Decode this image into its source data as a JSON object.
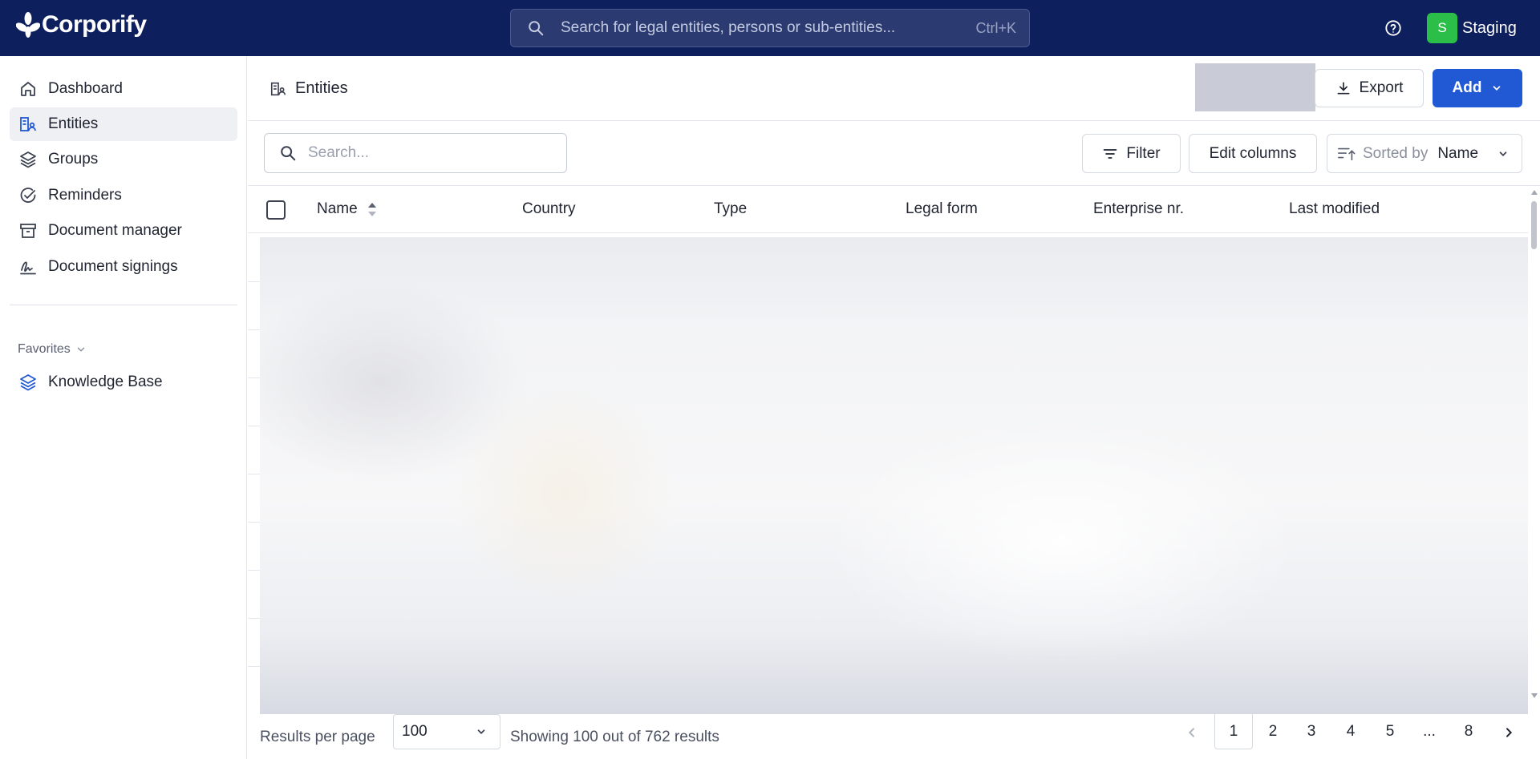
{
  "app": {
    "brand": "Corporify",
    "global_search_placeholder": "Search for legal entities, persons or sub-entities...",
    "global_search_shortcut": "Ctrl+K",
    "environment_initial": "S",
    "environment_name": "Staging",
    "environment_color": "#2bbf4a",
    "topbar_color": "#0d1f5c",
    "accent_color": "#2158d4"
  },
  "sidebar": {
    "items": [
      {
        "label": "Dashboard",
        "icon": "home-icon"
      },
      {
        "label": "Entities",
        "icon": "entities-icon",
        "active": true
      },
      {
        "label": "Groups",
        "icon": "layers-icon"
      },
      {
        "label": "Reminders",
        "icon": "check-circle-icon"
      },
      {
        "label": "Document manager",
        "icon": "archive-icon"
      },
      {
        "label": "Document signings",
        "icon": "signature-icon"
      }
    ],
    "favorites_label": "Favorites",
    "favorites": [
      {
        "label": "Knowledge Base",
        "icon": "layers-icon"
      }
    ]
  },
  "header": {
    "title": "Entities",
    "export_label": "Export",
    "add_label": "Add"
  },
  "toolbar": {
    "search_placeholder": "Search...",
    "filter_label": "Filter",
    "edit_columns_label": "Edit columns",
    "sort_prefix": "Sorted by",
    "sort_value": "Name"
  },
  "table": {
    "columns": [
      "Name",
      "Country",
      "Type",
      "Legal form",
      "Enterprise nr.",
      "Last modified"
    ]
  },
  "pagination": {
    "results_per_page_label": "Results per page",
    "results_per_page_value": "100",
    "results_text": "Showing 100 out of 762 results",
    "pages": [
      "1",
      "2",
      "3",
      "4",
      "5",
      "...",
      "8"
    ],
    "current_page": "1"
  }
}
